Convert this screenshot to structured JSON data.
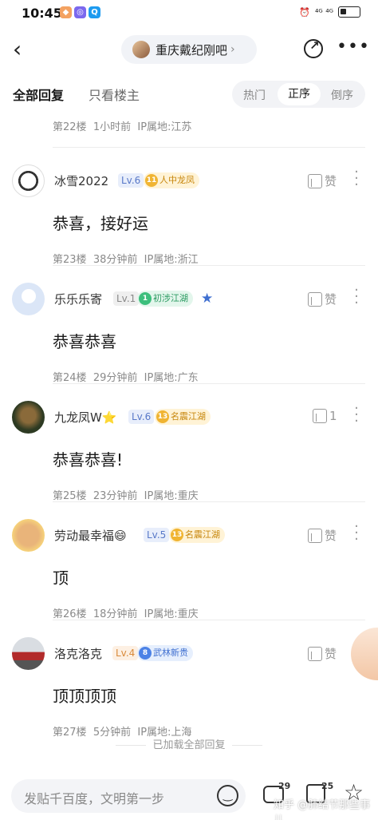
{
  "status_bar": {
    "time": "10:45",
    "network": "⁴ᴳ ⁴ᴳ"
  },
  "nav": {
    "forum_name": "重庆戴纪刚吧"
  },
  "tabs": {
    "all": "全部回复",
    "owner_only": "只看楼主",
    "sort_hot": "热门",
    "sort_asc": "正序",
    "sort_desc": "倒序"
  },
  "top_meta": {
    "floor": "第22楼",
    "time": "1小时前",
    "ip": "IP属地:江苏"
  },
  "replies": [
    {
      "username": "冰雪2022",
      "level": "Lv.6",
      "badge_num": "11",
      "badge_text": "人中龙凤",
      "content": "恭喜，接好运",
      "floor": "第23楼",
      "time": "38分钟前",
      "ip": "IP属地:浙江",
      "like": "赞"
    },
    {
      "username": "乐乐乐寄",
      "level": "Lv.1",
      "badge_num": "1",
      "badge_text": "初涉江湖",
      "content": "恭喜恭喜",
      "floor": "第24楼",
      "time": "29分钟前",
      "ip": "IP属地:广东",
      "like": "赞"
    },
    {
      "username": "九龙凤W⭐",
      "level": "Lv.6",
      "badge_num": "13",
      "badge_text": "名震江湖",
      "content": "恭喜恭喜!",
      "floor": "第25楼",
      "time": "23分钟前",
      "ip": "IP属地:重庆",
      "like": "1"
    },
    {
      "username": "劳动最幸福😄",
      "level": "Lv.5",
      "badge_num": "13",
      "badge_text": "名震江湖",
      "content": "顶",
      "floor": "第26楼",
      "time": "18分钟前",
      "ip": "IP属地:重庆",
      "like": "赞"
    },
    {
      "username": "洛克洛克",
      "level": "Lv.4",
      "badge_num": "8",
      "badge_text": "武林新贵",
      "content": "顶顶顶顶",
      "floor": "第27楼",
      "time": "5分钟前",
      "ip": "IP属地:上海",
      "like": "赞"
    }
  ],
  "loaded_text": "已加载全部回复",
  "bottom": {
    "placeholder": "发贴千百度，文明第一步",
    "comment_count": "29",
    "like_count": "25",
    "watermark": "知乎 @肺结节那些事儿"
  },
  "icons": [
    "back-icon",
    "share-icon",
    "more-icon",
    "thumb-up-icon",
    "kebab-icon",
    "emoji-icon",
    "comment-icon",
    "star-icon"
  ]
}
